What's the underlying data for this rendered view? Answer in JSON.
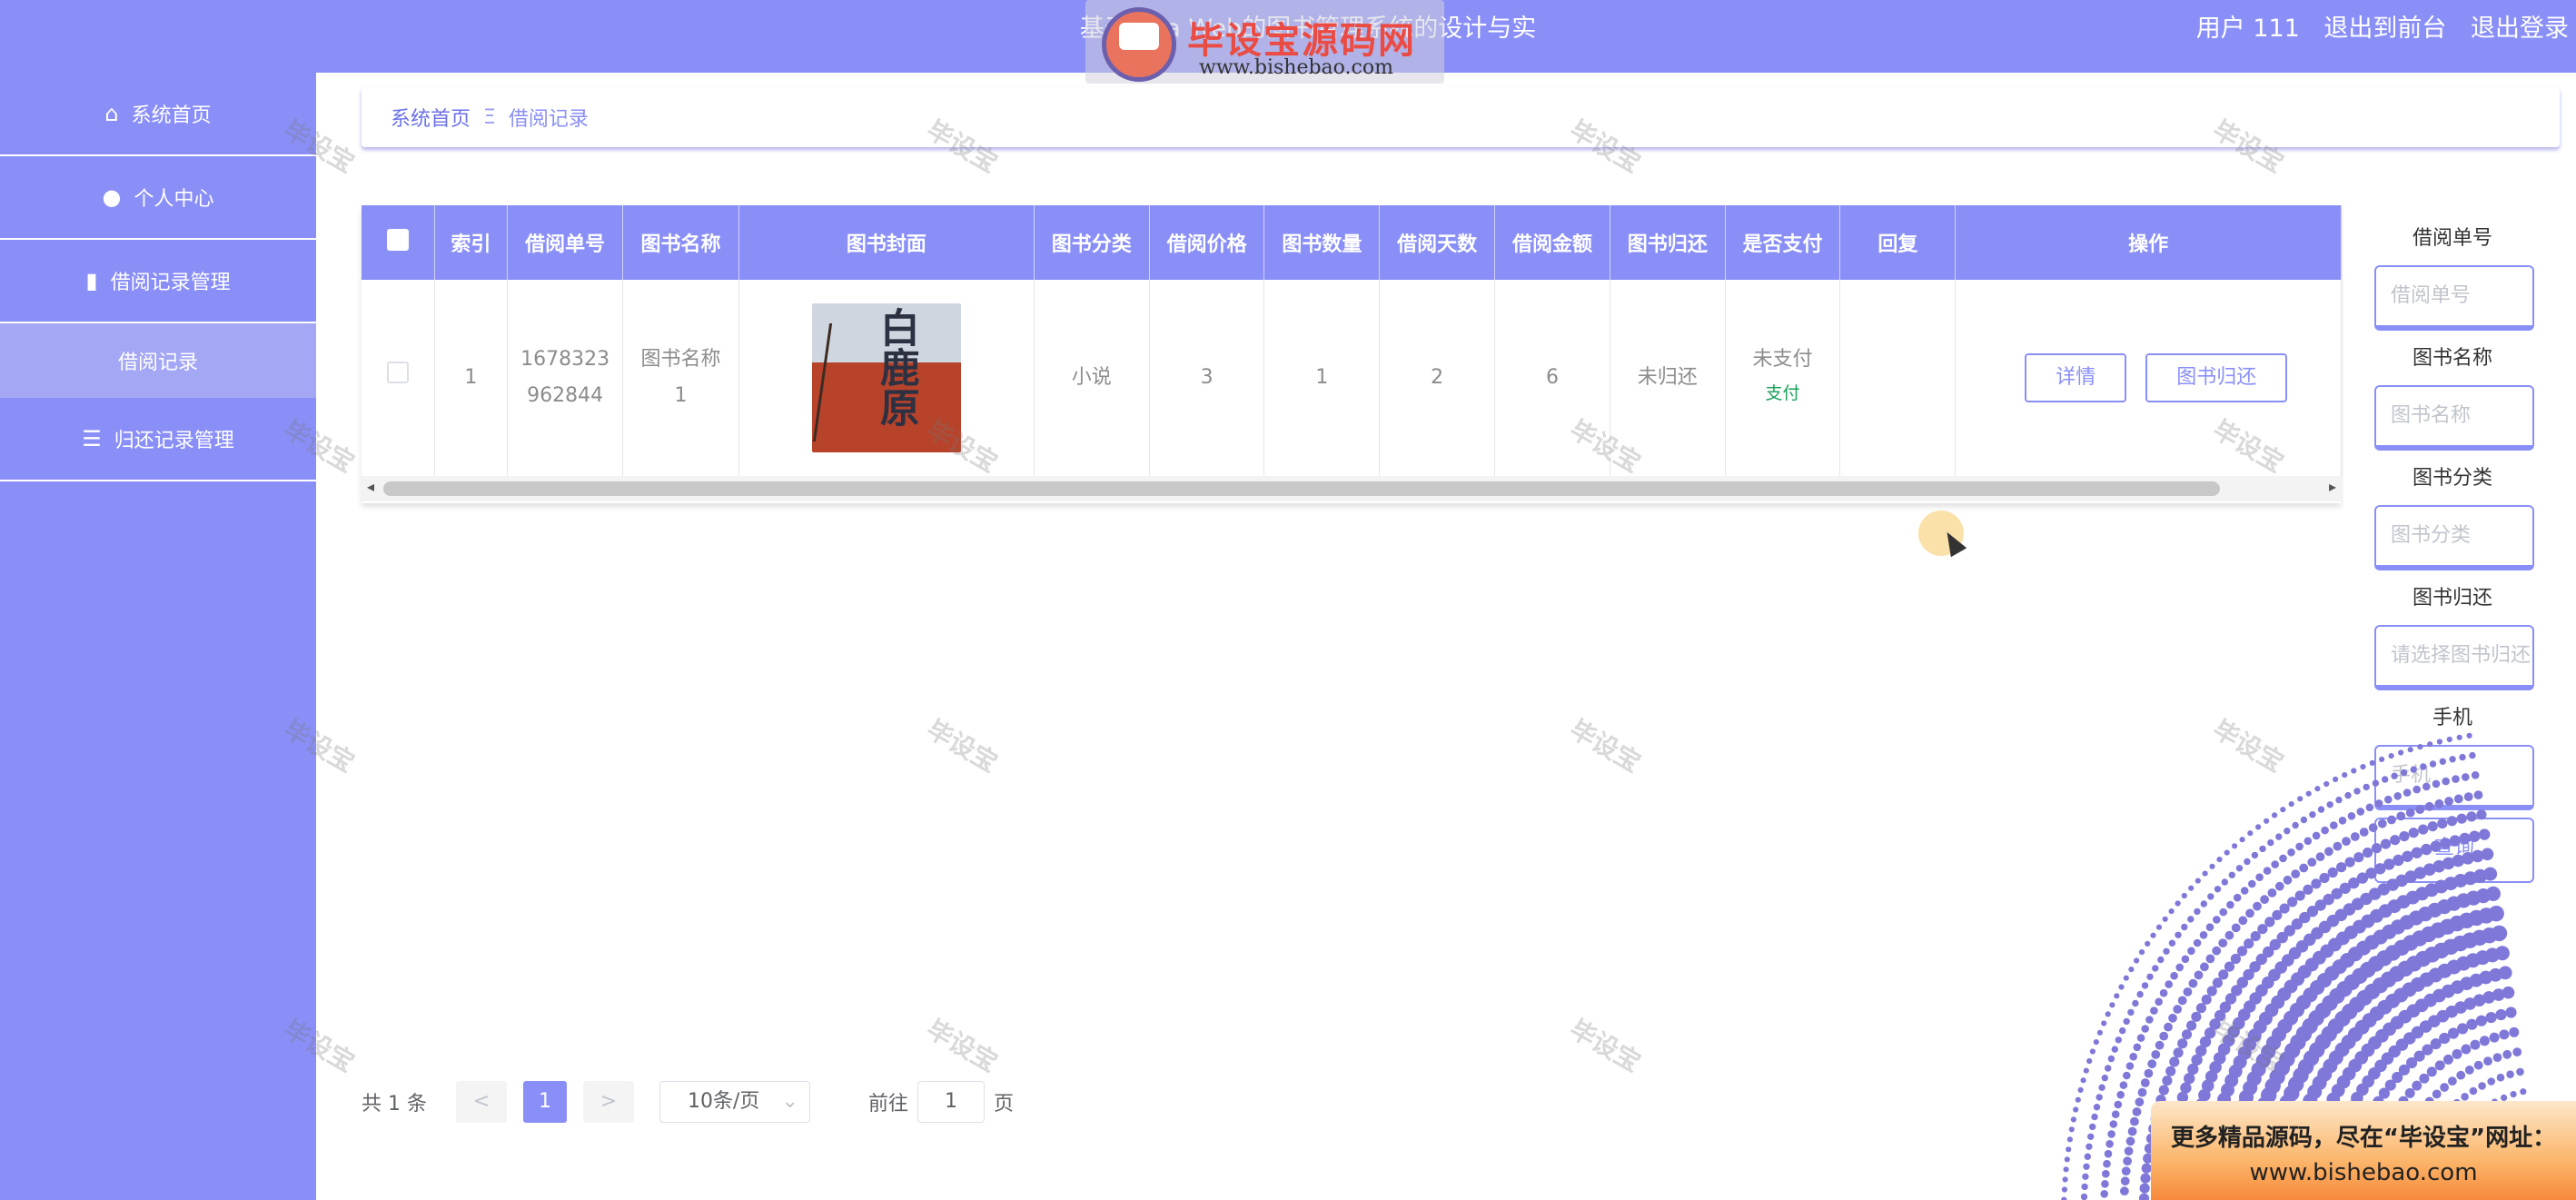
{
  "header": {
    "title": "基于Java Web的图书管理系统的设计与实现",
    "user_label": "用户 111",
    "back_to_front": "退出到前台",
    "logout": "退出登录"
  },
  "watermark_logo": {
    "main": "毕设宝源码网",
    "url": "www.bishebao.com"
  },
  "sidebar": {
    "items": [
      {
        "label": "系统首页",
        "icon": "home-icon"
      },
      {
        "label": "个人中心",
        "icon": "user-icon"
      },
      {
        "label": "借阅记录管理",
        "icon": "book-icon"
      },
      {
        "label": "借阅记录",
        "icon": ""
      },
      {
        "label": "归还记录管理",
        "icon": "list-icon"
      }
    ]
  },
  "breadcrumb": {
    "home": "系统首页",
    "separator": "Ξ",
    "current": "借阅记录"
  },
  "table": {
    "headers": [
      "索引",
      "借阅单号",
      "图书名称",
      "图书封面",
      "图书分类",
      "借阅价格",
      "图书数量",
      "借阅天数",
      "借阅金额",
      "图书归还",
      "是否支付",
      "回复",
      "操作"
    ],
    "rows": [
      {
        "index": "1",
        "order_no": "1678323962844",
        "book_name": "图书名称1",
        "cover_title": "白鹿原",
        "category": "小说",
        "price": "3",
        "quantity": "1",
        "days": "2",
        "amount": "6",
        "returned": "未归还",
        "paid": "未支付",
        "pay_link": "支付",
        "reply": "",
        "detail_btn": "详情",
        "return_btn": "图书归还"
      }
    ]
  },
  "search_panel": {
    "fields": [
      {
        "label": "借阅单号",
        "placeholder": "借阅单号"
      },
      {
        "label": "图书名称",
        "placeholder": "图书名称"
      },
      {
        "label": "图书分类",
        "placeholder": "图书分类"
      },
      {
        "label": "图书归还",
        "placeholder": "请选择图书归还"
      },
      {
        "label": "手机",
        "placeholder": "手机"
      }
    ],
    "search_btn": "查询"
  },
  "pagination": {
    "total": "共 1 条",
    "prev": "<",
    "current": "1",
    "next": ">",
    "page_size": "10条/页",
    "goto_label": "前往",
    "goto_value": "1",
    "page_unit": "页"
  },
  "bottom_banner": {
    "line1": "更多精品源码，尽在“毕设宝”网址：",
    "line2": "www.bishebao.com"
  },
  "watermark_text": "毕设宝",
  "colors": {
    "accent": "#8a8ff7",
    "pay_green": "#18a058",
    "banner_orange": "#f7893b"
  }
}
